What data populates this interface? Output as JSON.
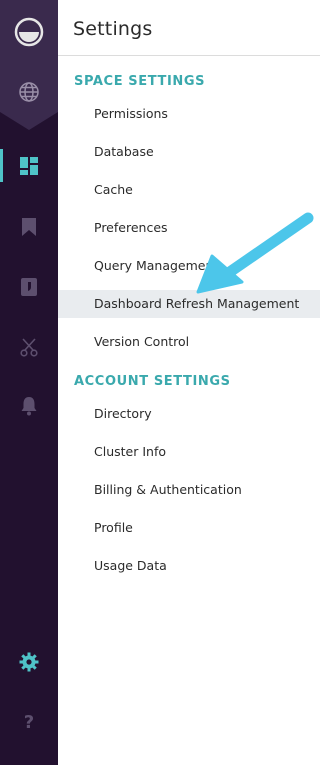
{
  "header": {
    "title": "Settings"
  },
  "sections": [
    {
      "heading": "SPACE SETTINGS",
      "items": [
        {
          "label": "Permissions"
        },
        {
          "label": "Database"
        },
        {
          "label": "Cache"
        },
        {
          "label": "Preferences"
        },
        {
          "label": "Query Management"
        },
        {
          "label": "Dashboard Refresh Management"
        },
        {
          "label": "Version Control"
        }
      ]
    },
    {
      "heading": "ACCOUNT SETTINGS",
      "items": [
        {
          "label": "Directory"
        },
        {
          "label": "Cluster Info"
        },
        {
          "label": "Billing & Authentication"
        },
        {
          "label": "Profile"
        },
        {
          "label": "Usage Data"
        }
      ]
    }
  ],
  "rail": {
    "icons": [
      "logo-icon",
      "globe-icon",
      "dashboard-icon",
      "bookmark-icon",
      "notebook-icon",
      "scissors-icon",
      "bell-icon",
      "gear-icon",
      "help-icon"
    ],
    "active_icon": "dashboard-icon",
    "selected_bottom_icon": "gear-icon"
  },
  "colors": {
    "rail_bg": "#22112f",
    "rail_top_bg": "#3a2a4d",
    "accent": "#4fc3c8",
    "section_heading": "#3aa9ad",
    "highlight_row": "#e9ecef",
    "callout_arrow": "#4cc6ea"
  },
  "callout": {
    "points_to": "Dashboard Refresh Management"
  }
}
